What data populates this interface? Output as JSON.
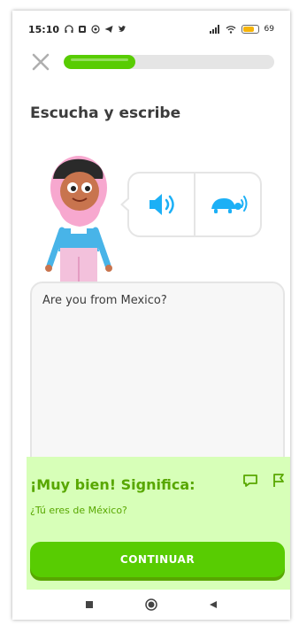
{
  "status_bar": {
    "time": "15:10",
    "battery_level": "69"
  },
  "lesson": {
    "progress": 0.34,
    "title": "Escucha y escribe"
  },
  "answer": {
    "text": "Are you from Mexico?"
  },
  "feedback": {
    "title": "¡Muy bien! Significa:",
    "translation": "¿Tú eres de México?",
    "continue_label": "CONTINUAR"
  },
  "colors": {
    "accent": "#58cc02",
    "accent_dark": "#58a700",
    "feedback_bg": "#d7ffb8",
    "audio_blue": "#1cb0f6"
  },
  "icons": [
    "close-icon",
    "speaker-icon",
    "turtle-icon",
    "comment-icon",
    "flag-icon",
    "square-icon",
    "circle-icon",
    "back-icon"
  ]
}
